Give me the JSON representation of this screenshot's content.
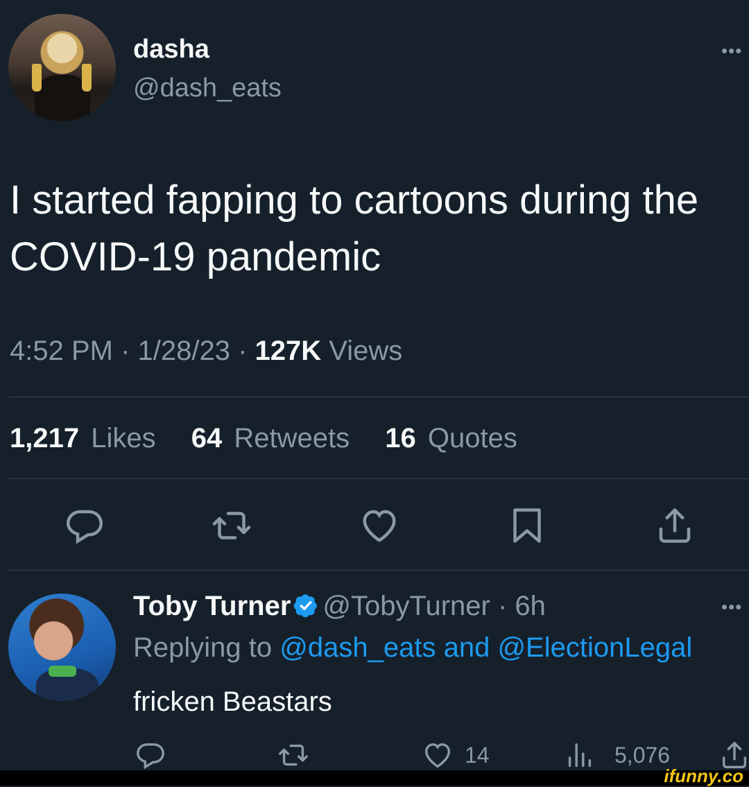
{
  "tweet": {
    "author_name": "dasha",
    "author_handle": "@dash_eats",
    "text": "I started fapping to cartoons during the COVID-19 pandemic",
    "time": "4:52 PM",
    "date": "1/28/23",
    "separator": " · ",
    "views_count": "127K",
    "views_label": "Views",
    "likes_count": "1,217",
    "likes_label": "Likes",
    "retweets_count": "64",
    "retweets_label": "Retweets",
    "quotes_count": "16",
    "quotes_label": "Quotes",
    "more": "•••"
  },
  "reply": {
    "author_name": "Toby Turner",
    "author_handle": "@TobyTurner",
    "age": " · 6h",
    "replying_prefix": "Replying to",
    "replying_mention1": "@dash_eats",
    "replying_and": "and",
    "replying_mention2": "@ElectionLegal",
    "text": "fricken Beastars",
    "likes": "14",
    "views": "5,076",
    "more": "•••"
  },
  "watermark": "ifunny.co",
  "colors": {
    "background": "#15202b",
    "text": "#f7f9f9",
    "muted": "#8b98a5",
    "accent": "#1d9bf0",
    "divider": "#38444d"
  },
  "icons": [
    "reply-icon",
    "retweet-icon",
    "like-icon",
    "bookmark-icon",
    "share-icon",
    "verified-badge-icon",
    "views-icon",
    "more-icon"
  ]
}
